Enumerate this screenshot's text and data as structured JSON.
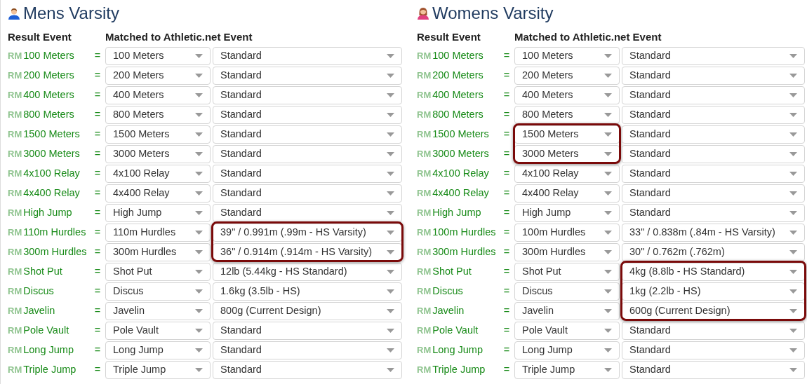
{
  "sections": [
    {
      "title": "Mens Varsity",
      "kind": "male",
      "columns": [
        "Result Event",
        "Matched to Athletic.net Event"
      ],
      "rows": [
        {
          "prefix": "RM",
          "event": "100 Meters",
          "equals": "=",
          "matched": "100 Meters",
          "variant": "Standard",
          "matched_highlight": false,
          "variant_highlight": false
        },
        {
          "prefix": "RM",
          "event": "200 Meters",
          "equals": "=",
          "matched": "200 Meters",
          "variant": "Standard",
          "matched_highlight": false,
          "variant_highlight": false
        },
        {
          "prefix": "RM",
          "event": "400 Meters",
          "equals": "=",
          "matched": "400 Meters",
          "variant": "Standard",
          "matched_highlight": false,
          "variant_highlight": false
        },
        {
          "prefix": "RM",
          "event": "800 Meters",
          "equals": "=",
          "matched": "800 Meters",
          "variant": "Standard",
          "matched_highlight": false,
          "variant_highlight": false
        },
        {
          "prefix": "RM",
          "event": "1500 Meters",
          "equals": "=",
          "matched": "1500 Meters",
          "variant": "Standard",
          "matched_highlight": false,
          "variant_highlight": false
        },
        {
          "prefix": "RM",
          "event": "3000 Meters",
          "equals": "=",
          "matched": "3000 Meters",
          "variant": "Standard",
          "matched_highlight": false,
          "variant_highlight": false
        },
        {
          "prefix": "RM",
          "event": "4x100 Relay",
          "equals": "=",
          "matched": "4x100 Relay",
          "variant": "Standard",
          "matched_highlight": false,
          "variant_highlight": false
        },
        {
          "prefix": "RM",
          "event": "4x400 Relay",
          "equals": "=",
          "matched": "4x400 Relay",
          "variant": "Standard",
          "matched_highlight": false,
          "variant_highlight": false
        },
        {
          "prefix": "RM",
          "event": "High Jump",
          "equals": "=",
          "matched": "High Jump",
          "variant": "Standard",
          "matched_highlight": false,
          "variant_highlight": false
        },
        {
          "prefix": "RM",
          "event": "110m Hurdles",
          "equals": "=",
          "matched": "110m Hurdles",
          "variant": "39\" / 0.991m (.99m - HS Varsity)",
          "matched_highlight": false,
          "variant_highlight": true
        },
        {
          "prefix": "RM",
          "event": "300m Hurdles",
          "equals": "=",
          "matched": "300m Hurdles",
          "variant": "36\" / 0.914m (.914m - HS Varsity)",
          "matched_highlight": false,
          "variant_highlight": true
        },
        {
          "prefix": "RM",
          "event": "Shot Put",
          "equals": "=",
          "matched": "Shot Put",
          "variant": "12lb (5.44kg - HS Standard)",
          "matched_highlight": false,
          "variant_highlight": false
        },
        {
          "prefix": "RM",
          "event": "Discus",
          "equals": "=",
          "matched": "Discus",
          "variant": "1.6kg (3.5lb - HS)",
          "matched_highlight": false,
          "variant_highlight": false
        },
        {
          "prefix": "RM",
          "event": "Javelin",
          "equals": "=",
          "matched": "Javelin",
          "variant": "800g (Current Design)",
          "matched_highlight": false,
          "variant_highlight": false
        },
        {
          "prefix": "RM",
          "event": "Pole Vault",
          "equals": "=",
          "matched": "Pole Vault",
          "variant": "Standard",
          "matched_highlight": false,
          "variant_highlight": false
        },
        {
          "prefix": "RM",
          "event": "Long Jump",
          "equals": "=",
          "matched": "Long Jump",
          "variant": "Standard",
          "matched_highlight": false,
          "variant_highlight": false
        },
        {
          "prefix": "RM",
          "event": "Triple Jump",
          "equals": "=",
          "matched": "Triple Jump",
          "variant": "Standard",
          "matched_highlight": false,
          "variant_highlight": false
        }
      ]
    },
    {
      "title": "Womens Varsity",
      "kind": "female",
      "columns": [
        "Result Event",
        "Matched to Athletic.net Event"
      ],
      "rows": [
        {
          "prefix": "RM",
          "event": "100 Meters",
          "equals": "=",
          "matched": "100 Meters",
          "variant": "Standard",
          "matched_highlight": false,
          "variant_highlight": false
        },
        {
          "prefix": "RM",
          "event": "200 Meters",
          "equals": "=",
          "matched": "200 Meters",
          "variant": "Standard",
          "matched_highlight": false,
          "variant_highlight": false
        },
        {
          "prefix": "RM",
          "event": "400 Meters",
          "equals": "=",
          "matched": "400 Meters",
          "variant": "Standard",
          "matched_highlight": false,
          "variant_highlight": false
        },
        {
          "prefix": "RM",
          "event": "800 Meters",
          "equals": "=",
          "matched": "800 Meters",
          "variant": "Standard",
          "matched_highlight": false,
          "variant_highlight": false
        },
        {
          "prefix": "RM",
          "event": "1500 Meters",
          "equals": "=",
          "matched": "1500 Meters",
          "variant": "Standard",
          "matched_highlight": true,
          "variant_highlight": false
        },
        {
          "prefix": "RM",
          "event": "3000 Meters",
          "equals": "=",
          "matched": "3000 Meters",
          "variant": "Standard",
          "matched_highlight": true,
          "variant_highlight": false
        },
        {
          "prefix": "RM",
          "event": "4x100 Relay",
          "equals": "=",
          "matched": "4x100 Relay",
          "variant": "Standard",
          "matched_highlight": false,
          "variant_highlight": false
        },
        {
          "prefix": "RM",
          "event": "4x400 Relay",
          "equals": "=",
          "matched": "4x400 Relay",
          "variant": "Standard",
          "matched_highlight": false,
          "variant_highlight": false
        },
        {
          "prefix": "RM",
          "event": "High Jump",
          "equals": "=",
          "matched": "High Jump",
          "variant": "Standard",
          "matched_highlight": false,
          "variant_highlight": false
        },
        {
          "prefix": "RM",
          "event": "100m Hurdles",
          "equals": "=",
          "matched": "100m Hurdles",
          "variant": "33\" / 0.838m (.84m - HS Varsity)",
          "matched_highlight": false,
          "variant_highlight": false
        },
        {
          "prefix": "RM",
          "event": "300m Hurdles",
          "equals": "=",
          "matched": "300m Hurdles",
          "variant": "30\" / 0.762m (.762m)",
          "matched_highlight": false,
          "variant_highlight": false
        },
        {
          "prefix": "RM",
          "event": "Shot Put",
          "equals": "=",
          "matched": "Shot Put",
          "variant": "4kg (8.8lb - HS Standard)",
          "matched_highlight": false,
          "variant_highlight": true
        },
        {
          "prefix": "RM",
          "event": "Discus",
          "equals": "=",
          "matched": "Discus",
          "variant": "1kg (2.2lb - HS)",
          "matched_highlight": false,
          "variant_highlight": true
        },
        {
          "prefix": "RM",
          "event": "Javelin",
          "equals": "=",
          "matched": "Javelin",
          "variant": "600g (Current Design)",
          "matched_highlight": false,
          "variant_highlight": true
        },
        {
          "prefix": "RM",
          "event": "Pole Vault",
          "equals": "=",
          "matched": "Pole Vault",
          "variant": "Standard",
          "matched_highlight": false,
          "variant_highlight": false
        },
        {
          "prefix": "RM",
          "event": "Long Jump",
          "equals": "=",
          "matched": "Long Jump",
          "variant": "Standard",
          "matched_highlight": false,
          "variant_highlight": false
        },
        {
          "prefix": "RM",
          "event": "Triple Jump",
          "equals": "=",
          "matched": "Triple Jump",
          "variant": "Standard",
          "matched_highlight": false,
          "variant_highlight": false
        }
      ]
    }
  ]
}
